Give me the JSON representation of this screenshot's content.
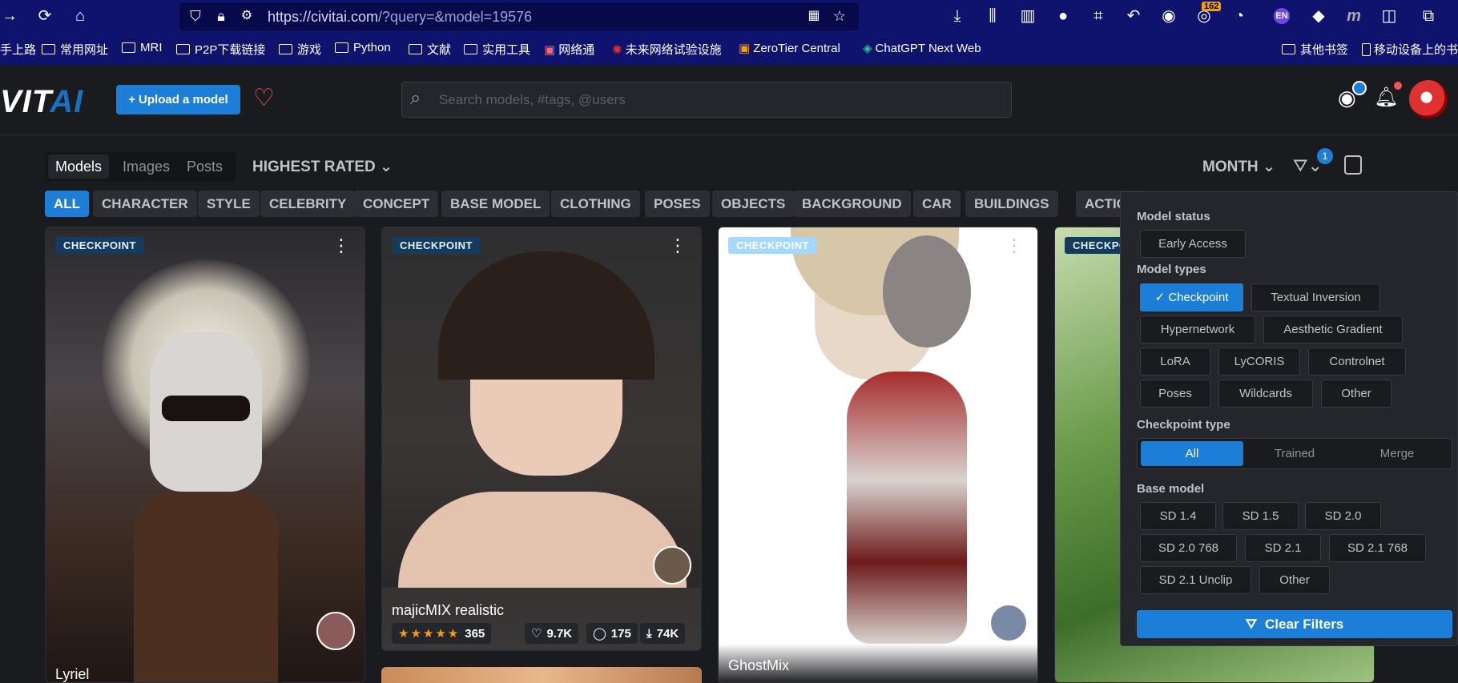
{
  "browser": {
    "url_host": "https://civitai.com",
    "url_path": "/?query=&model=19576",
    "toolbar_badge": "162",
    "bookmarks": [
      "手上路",
      "常用网址",
      "MRI",
      "P2P下载链接",
      "游戏",
      "Python",
      "文献",
      "实用工具",
      "网络通",
      "未来网络试验设施",
      "ZeroTier Central",
      "ChatGPT Next Web",
      "其他书签",
      "移动设备上的书"
    ]
  },
  "app": {
    "logo_main": "VIT",
    "logo_accent": "AI",
    "upload_label": "Upload a model",
    "search_placeholder": "Search models, #tags, @users"
  },
  "filters": {
    "tabs": [
      "Models",
      "Images",
      "Posts"
    ],
    "sort_label": "HIGHEST RATED",
    "period_label": "MONTH",
    "filter_count": "1",
    "categories": [
      "ALL",
      "CHARACTER",
      "STYLE",
      "CELEBRITY",
      "CONCEPT",
      "BASE MODEL",
      "CLOTHING",
      "POSES",
      "OBJECTS",
      "BACKGROUND",
      "CAR",
      "BUILDINGS",
      "ACTION"
    ]
  },
  "cards": [
    {
      "badge": "CHECKPOINT",
      "title": "Lyriel"
    },
    {
      "badge": "CHECKPOINT",
      "title": "majicMIX realistic",
      "rating_count": "365",
      "likes": "9.7K",
      "comments": "175",
      "downloads": "74K"
    },
    {
      "badge": "CHECKPOINT",
      "title": "GhostMix"
    },
    {
      "badge": "CHECKPOINT",
      "title": ""
    }
  ],
  "popover": {
    "model_status_title": "Model status",
    "model_status": [
      "Early Access"
    ],
    "model_types_title": "Model types",
    "model_types": [
      "Checkpoint",
      "Textual Inversion",
      "Hypernetwork",
      "Aesthetic Gradient",
      "LoRA",
      "LyCORIS",
      "Controlnet",
      "Poses",
      "Wildcards",
      "Other"
    ],
    "checkpoint_type_title": "Checkpoint type",
    "checkpoint_types": [
      "All",
      "Trained",
      "Merge"
    ],
    "base_model_title": "Base model",
    "base_models": [
      "SD 1.4",
      "SD 1.5",
      "SD 2.0",
      "SD 2.0 768",
      "SD 2.1",
      "SD 2.1 768",
      "SD 2.1 Unclip",
      "Other"
    ],
    "clear_label": "Clear Filters"
  }
}
